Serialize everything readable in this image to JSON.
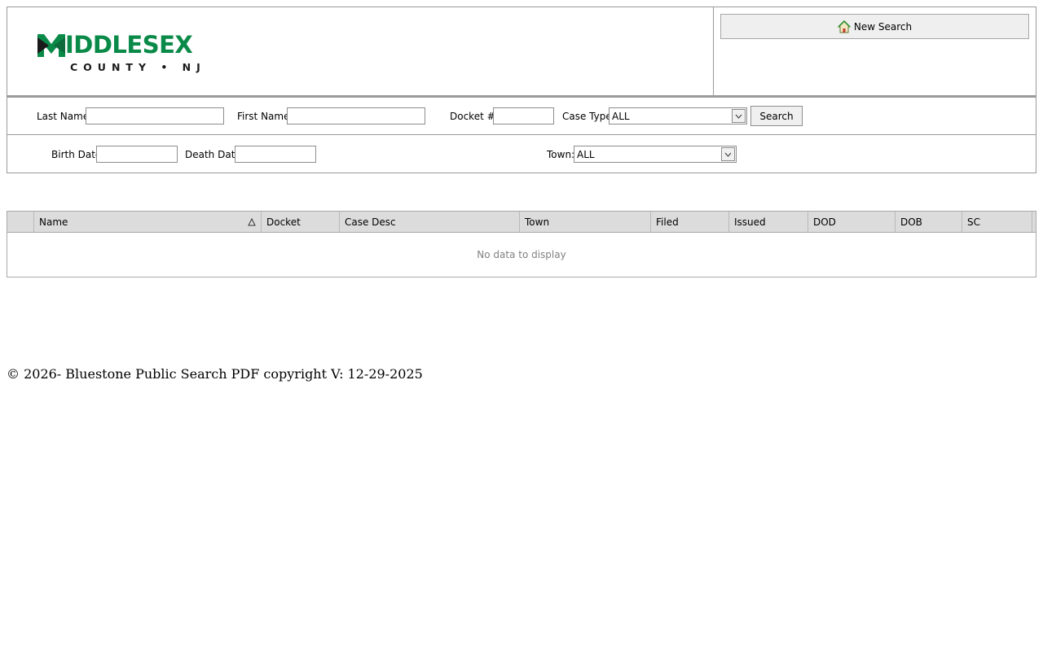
{
  "header": {
    "logo": {
      "word": "MIDDLESEX",
      "word_shown": "IDDLESEX",
      "sub": "COUNTY • NJ",
      "brand_color": "#0a8a48"
    },
    "new_search_label": "New Search",
    "new_search_icon": "home-icon"
  },
  "filters": {
    "last_name": {
      "label": "Last Name",
      "value": ""
    },
    "first_name": {
      "label": "First Name",
      "value": ""
    },
    "docket": {
      "label": "Docket #",
      "value": ""
    },
    "case_type": {
      "label": "Case Type",
      "selected": "ALL"
    },
    "search_label": "Search",
    "birth_date": {
      "label": "Birth Date",
      "value": ""
    },
    "death_date": {
      "label": "Death Date",
      "value": ""
    },
    "town": {
      "label": "Town:",
      "selected": "ALL"
    }
  },
  "grid": {
    "columns": [
      "",
      "Name",
      "Docket",
      "Case Desc",
      "Town",
      "Filed",
      "Issued",
      "DOD",
      "DOB",
      "SC"
    ],
    "sorted_column": "Name",
    "sort_direction": "ascending",
    "empty_text": "No data to display"
  },
  "footer": {
    "text": "© 2026- Bluestone Public Search PDF copyright V: 12-29-2025"
  }
}
